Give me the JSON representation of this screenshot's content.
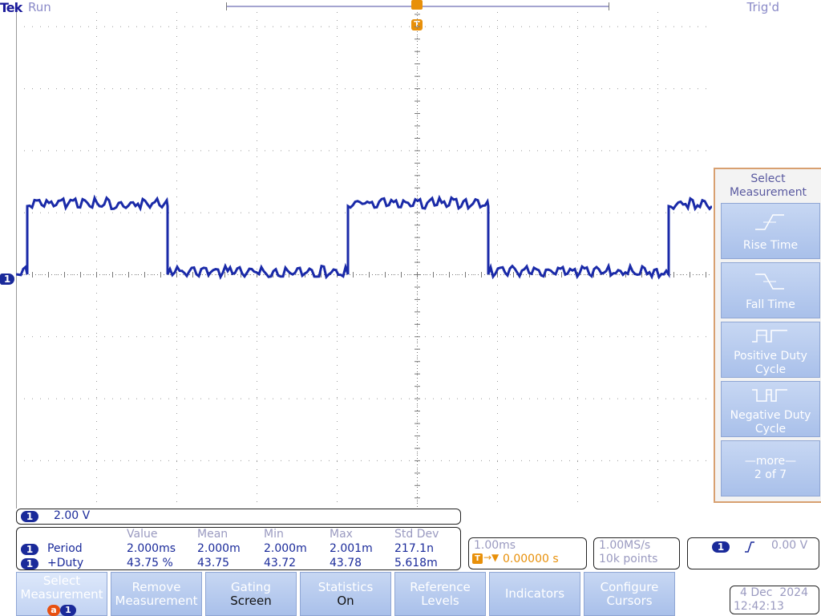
{
  "header": {
    "brand": "Tek",
    "run_state": "Run",
    "trigger_state": "Trig'd",
    "trigger_marker": "T"
  },
  "channel": {
    "number": "1",
    "volts_per_div": "2.00 V"
  },
  "measurements": {
    "headers": [
      "Value",
      "Mean",
      "Min",
      "Max",
      "Std Dev"
    ],
    "rows": [
      {
        "ch": "1",
        "name": "Period",
        "value": "2.000ms",
        "mean": "2.000m",
        "min": "2.000m",
        "max": "2.001m",
        "std": "217.1n"
      },
      {
        "ch": "1",
        "name": "+Duty",
        "value": "43.75 %",
        "mean": "43.75",
        "min": "43.72",
        "max": "43.78",
        "std": "5.618m"
      }
    ]
  },
  "timebase": {
    "scale": "1.00ms",
    "trigger_position": "0.00000 s"
  },
  "acquisition": {
    "sample_rate": "1.00MS/s",
    "record_length": "10k points"
  },
  "trigger": {
    "channel": "1",
    "level": "0.00 V",
    "slope_icon": "rising-edge-icon"
  },
  "datetime": {
    "date": "4 Dec  2024",
    "time": "12:42:13"
  },
  "side_menu": {
    "title": "Select Measurement",
    "items": [
      {
        "label": "Rise Time",
        "icon": "rise-time-icon"
      },
      {
        "label": "Fall Time",
        "icon": "fall-time-icon"
      },
      {
        "label": "Positive Duty Cycle",
        "icon": "positive-duty-icon"
      },
      {
        "label": "Negative Duty Cycle",
        "icon": "negative-duty-icon"
      },
      {
        "label": "—more—",
        "sub": "2 of 7"
      }
    ]
  },
  "bottom_menu": {
    "select": {
      "label": "Select Measurement",
      "badge_a": "a",
      "badge_1": "1"
    },
    "remove": "Remove Measurement",
    "gating": {
      "label": "Gating",
      "value": "Screen"
    },
    "statistics": {
      "label": "Statistics",
      "value": "On"
    },
    "reference": "Reference Levels",
    "indicators": "Indicators",
    "configure": "Configure Cursors"
  },
  "waveform": {
    "type": "square",
    "period_divisions": 4,
    "duty": 0.4375,
    "high_divisions": 1.1,
    "low_divisions": 0,
    "color": "#1a2aa8"
  },
  "colors": {
    "accent_blue": "#1a2a9a",
    "accent_orange": "#e8900a",
    "menu_border": "#d8a070"
  }
}
